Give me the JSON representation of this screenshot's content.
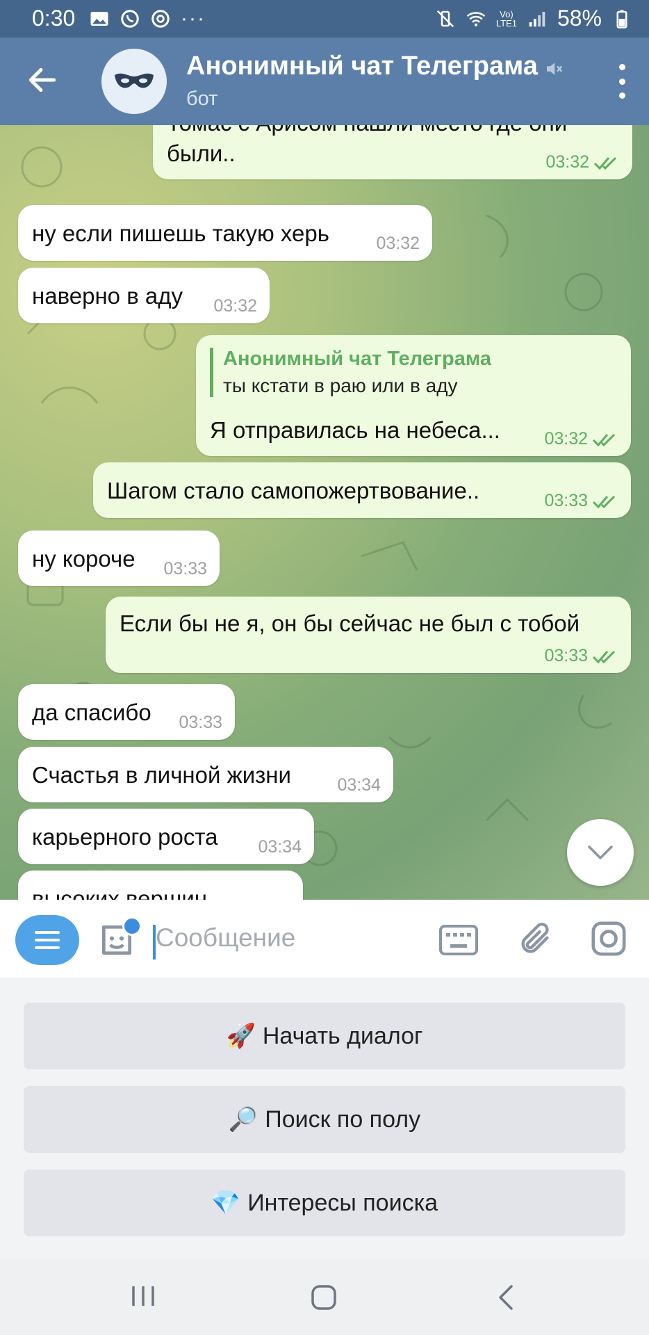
{
  "status_bar": {
    "time": "0:30",
    "battery": "58%"
  },
  "header": {
    "title": "Анонимный чат Телеграма",
    "subtitle": "бот"
  },
  "messages": [
    {
      "dir": "out",
      "text_line1": "Томас с Арисом нашли место где они",
      "text_line2": "были..",
      "time": "03:32"
    },
    {
      "dir": "in",
      "text": "ну если пишешь такую херь",
      "time": "03:32"
    },
    {
      "dir": "in",
      "text": "наверно в аду",
      "time": "03:32"
    },
    {
      "dir": "out",
      "reply_name": "Анонимный чат Телеграма",
      "reply_text": "ты кстати в раю или в аду",
      "text": "Я отправилась на небеса...",
      "time": "03:32"
    },
    {
      "dir": "out",
      "text": "Шагом стало самопожертвование..",
      "time": "03:33"
    },
    {
      "dir": "in",
      "text": "ну короче",
      "time": "03:33"
    },
    {
      "dir": "out",
      "text": "Если бы не я, он бы сейчас не был с тобой",
      "time": "03:33"
    },
    {
      "dir": "in",
      "text": "да спасибо",
      "time": "03:33"
    },
    {
      "dir": "in",
      "text": "Счастья в личной жизни",
      "time": "03:34"
    },
    {
      "dir": "in",
      "text": "карьерного роста",
      "time": "03:34"
    },
    {
      "dir": "in",
      "text": "высоких вершин",
      "time": ""
    }
  ],
  "input": {
    "placeholder": "Сообщение"
  },
  "keyboard": [
    {
      "emoji": "🚀",
      "label": "Начать диалог"
    },
    {
      "emoji": "🔎",
      "label": "Поиск по полу"
    },
    {
      "emoji": "💎",
      "label": "Интересы поиска"
    }
  ],
  "colors": {
    "header": "#5b7fa8",
    "status_bar": "#45668c",
    "outgoing_bubble": "#eefbdf",
    "accent_green": "#5fae62",
    "accent_blue": "#4fa3e6"
  },
  "icons": [
    "back-arrow-icon",
    "mask-icon",
    "mute-icon",
    "kebab-menu-icon",
    "double-check-icon",
    "chevron-down-icon",
    "menu-icon",
    "sticker-icon",
    "keyboard-icon",
    "attach-icon",
    "camera-icon"
  ]
}
